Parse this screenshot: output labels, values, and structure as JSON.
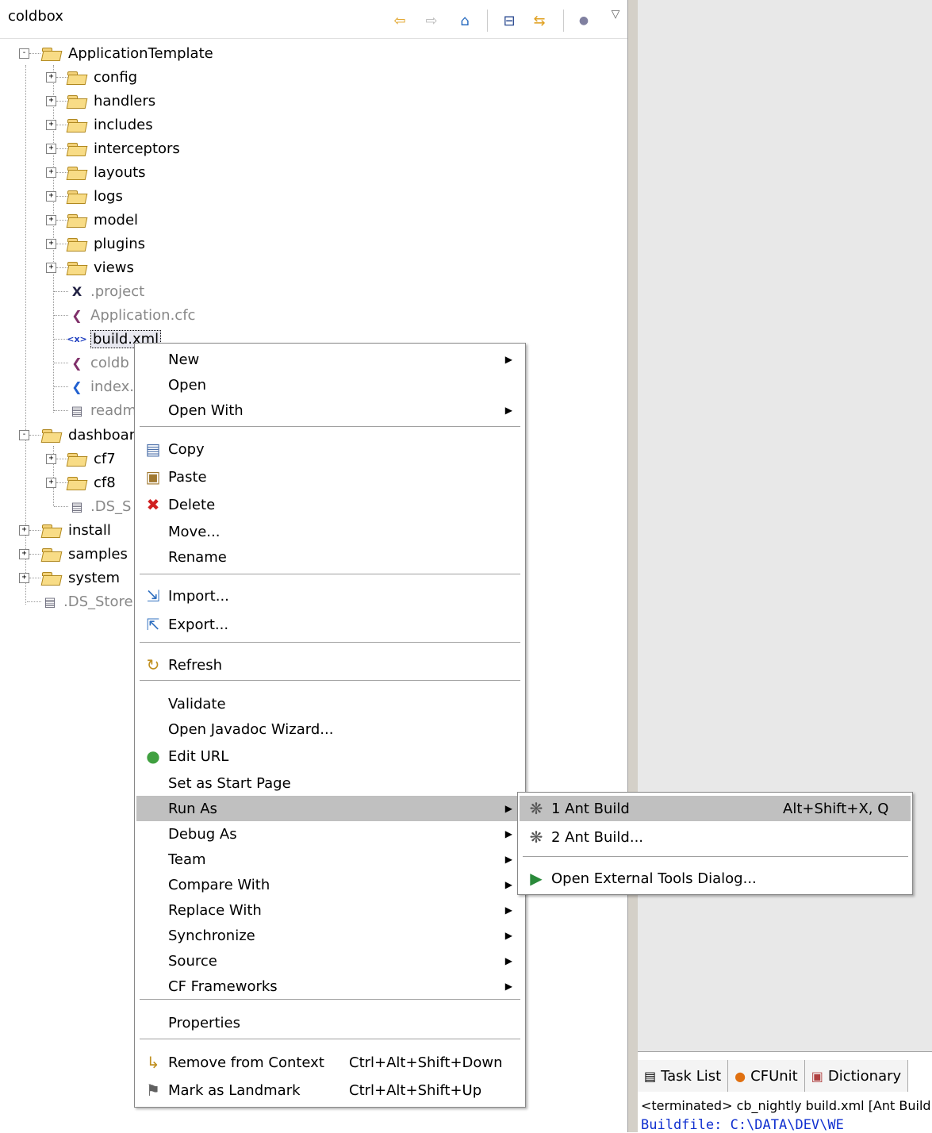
{
  "explorer": {
    "title": "coldbox",
    "toolbar_icons": [
      "back-arrow-icon",
      "forward-arrow-icon",
      "home-icon",
      "collapse-all-icon",
      "link-editor-icon",
      "options-icon",
      "view-menu-icon"
    ],
    "tree": [
      {
        "label": "ApplicationTemplate",
        "type": "folder",
        "expanded": true
      },
      {
        "label": "config",
        "type": "folder"
      },
      {
        "label": "handlers",
        "type": "folder"
      },
      {
        "label": "includes",
        "type": "folder"
      },
      {
        "label": "interceptors",
        "type": "folder"
      },
      {
        "label": "layouts",
        "type": "folder"
      },
      {
        "label": "logs",
        "type": "folder"
      },
      {
        "label": "model",
        "type": "folder"
      },
      {
        "label": "plugins",
        "type": "folder"
      },
      {
        "label": "views",
        "type": "folder"
      },
      {
        "label": ".project",
        "type": "file"
      },
      {
        "label": "Application.cfc",
        "type": "file"
      },
      {
        "label": "build.xml",
        "type": "file"
      },
      {
        "label": "coldb",
        "type": "file"
      },
      {
        "label": "index.",
        "type": "file"
      },
      {
        "label": "readm",
        "type": "file"
      },
      {
        "label": "dashboar",
        "type": "folder",
        "expanded": true
      },
      {
        "label": "cf7",
        "type": "folder"
      },
      {
        "label": "cf8",
        "type": "folder"
      },
      {
        "label": ".DS_S",
        "type": "file"
      },
      {
        "label": "install",
        "type": "folder"
      },
      {
        "label": "samples",
        "type": "folder"
      },
      {
        "label": "system",
        "type": "folder"
      },
      {
        "label": ".DS_Store",
        "type": "file"
      }
    ]
  },
  "context_menu": {
    "items": [
      {
        "label": "New",
        "submenu": true
      },
      {
        "label": "Open"
      },
      {
        "label": "Open With",
        "submenu": true
      },
      {
        "label": "Copy",
        "icon": "copy-icon"
      },
      {
        "label": "Paste",
        "icon": "paste-icon"
      },
      {
        "label": "Delete",
        "icon": "delete-icon"
      },
      {
        "label": "Move..."
      },
      {
        "label": "Rename"
      },
      {
        "label": "Import...",
        "icon": "import-icon"
      },
      {
        "label": "Export...",
        "icon": "export-icon"
      },
      {
        "label": "Refresh",
        "icon": "refresh-icon"
      },
      {
        "label": "Validate"
      },
      {
        "label": "Open Javadoc Wizard..."
      },
      {
        "label": "Edit URL",
        "icon": "globe-icon"
      },
      {
        "label": "Set as Start Page"
      },
      {
        "label": "Run As",
        "submenu": true,
        "highlighted": true
      },
      {
        "label": "Debug As",
        "submenu": true
      },
      {
        "label": "Team",
        "submenu": true
      },
      {
        "label": "Compare With",
        "submenu": true
      },
      {
        "label": "Replace With",
        "submenu": true
      },
      {
        "label": "Synchronize",
        "submenu": true
      },
      {
        "label": "Source",
        "submenu": true
      },
      {
        "label": "CF Frameworks",
        "submenu": true
      },
      {
        "label": "Properties"
      },
      {
        "label": "Remove from Context",
        "shortcut": "Ctrl+Alt+Shift+Down",
        "icon": "remove-context-icon"
      },
      {
        "label": "Mark as Landmark",
        "shortcut": "Ctrl+Alt+Shift+Up",
        "icon": "landmark-icon"
      }
    ]
  },
  "run_as_submenu": {
    "items": [
      {
        "label": "1 Ant Build",
        "shortcut": "Alt+Shift+X, Q",
        "icon": "ant-icon",
        "highlighted": true
      },
      {
        "label": "2 Ant Build...",
        "icon": "ant-icon"
      },
      {
        "label": "Open External Tools Dialog...",
        "icon": "external-tools-icon"
      }
    ]
  },
  "bottom_view": {
    "tabs": [
      {
        "label": "Task List",
        "icon": "task-list-icon"
      },
      {
        "label": "CFUnit",
        "icon": "cfunit-icon"
      },
      {
        "label": "Dictionary",
        "icon": "dictionary-icon"
      }
    ],
    "console_line1": "<terminated> cb_nightly build.xml [Ant Build",
    "console_line2": "Buildfile: C:\\DATA\\DEV\\WE"
  },
  "colors": {
    "menu_highlight": "#c0c0c0",
    "console_text": "#1030d0",
    "sash": "#d4d0c8"
  }
}
